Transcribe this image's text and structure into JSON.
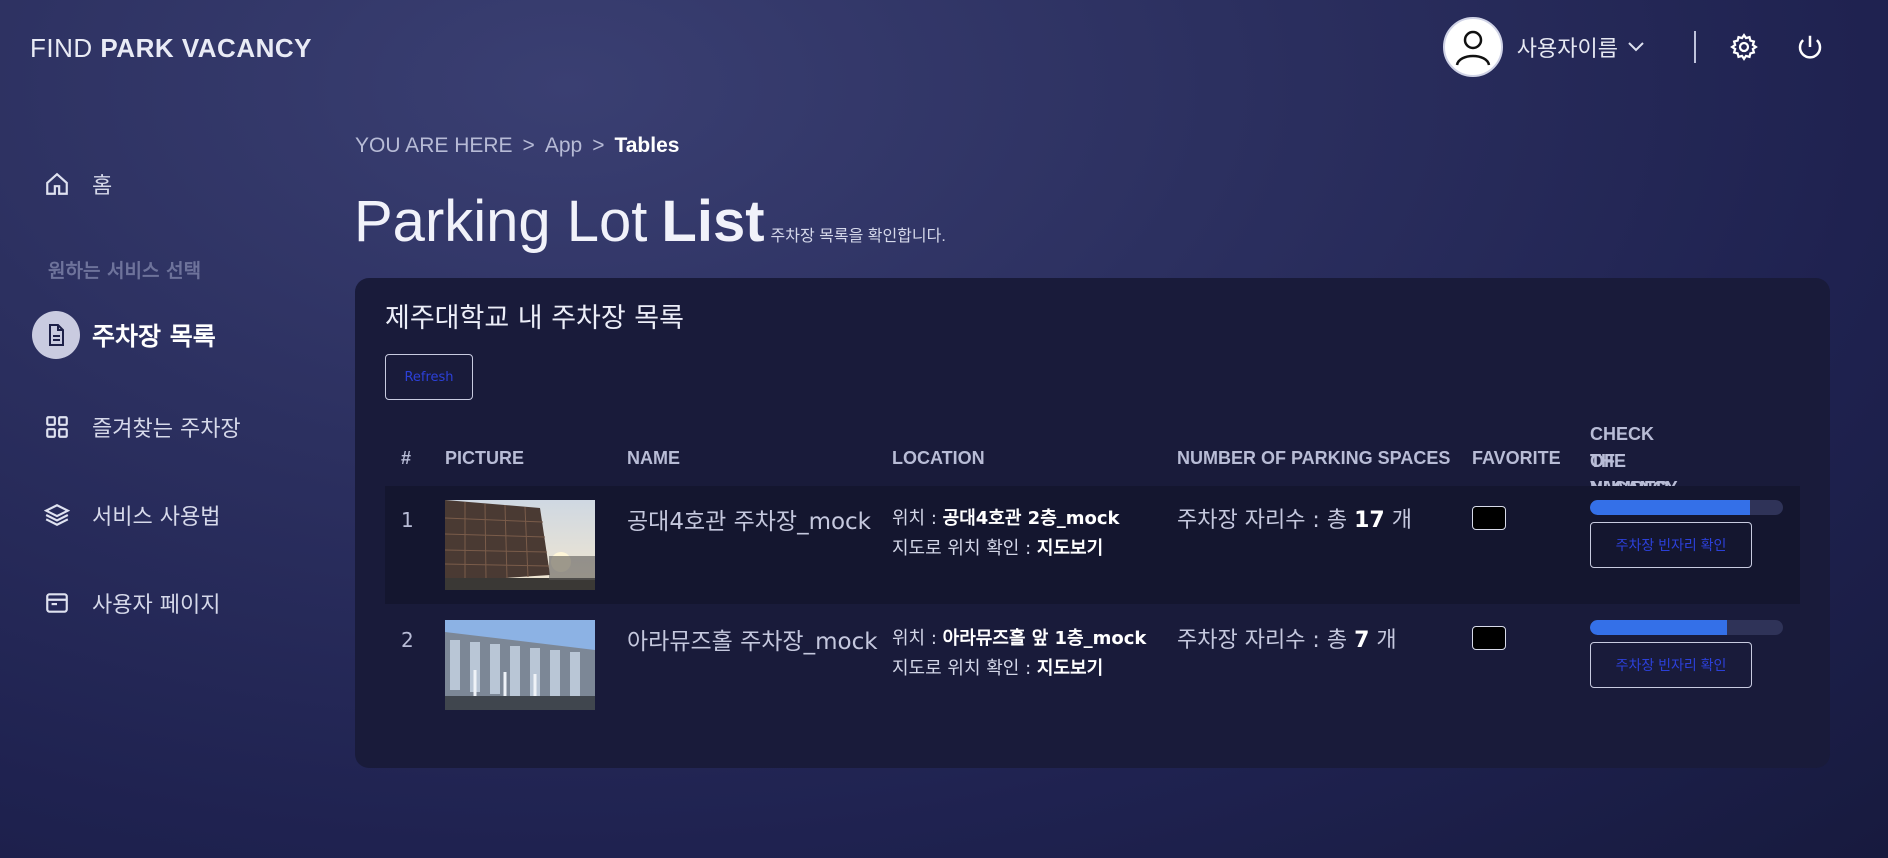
{
  "header": {
    "logo_light": "FIND ",
    "logo_bold": "PARK VACANCY",
    "username": "사용자이름",
    "icons": [
      "user-avatar-icon",
      "chevron-down-icon",
      "gear-icon",
      "power-icon"
    ]
  },
  "sidebar": {
    "home": "홈",
    "section_label": "원하는 서비스 선택",
    "items": [
      {
        "label": "주차장 목록",
        "icon": "document-icon",
        "active": true
      },
      {
        "label": "즐겨찾는 주차장",
        "icon": "grid-icon",
        "active": false
      },
      {
        "label": "서비스 사용법",
        "icon": "layers-icon",
        "active": false
      },
      {
        "label": "사용자 페이지",
        "icon": "browser-window-icon",
        "active": false
      }
    ]
  },
  "breadcrumb": {
    "prefix": "YOU ARE HERE",
    "sep": ">",
    "app": "App",
    "current": "Tables"
  },
  "page": {
    "title_light": "Parking Lot",
    "title_bold": "List",
    "subtitle": "주차장 목록을 확인합니다."
  },
  "card": {
    "title": "제주대학교 내 주차장 목록",
    "refresh_label": "Refresh"
  },
  "table": {
    "headers": {
      "num": "#",
      "picture": "PICTURE",
      "name": "NAME",
      "location": "LOCATION",
      "spaces": "NUMBER OF PARKING SPACES",
      "favorite": "FAVORITE",
      "vacancy_line1": "CHECK THE NUMBER",
      "vacancy_line2": "OF VACANCY"
    },
    "rows": [
      {
        "num": "1",
        "name": "공대4호관 주차장_mock",
        "loc_label": "위치 :",
        "loc_value": "공대4호관 2층_mock",
        "map_label": "지도로 위치 확인 :",
        "map_link": "지도보기",
        "spaces_prefix": "주차장 자리수 : 총",
        "spaces_count": "17",
        "spaces_unit": "개",
        "vacancy_ratio": 0.83,
        "vacancy_button": "주차장 빈자리 확인"
      },
      {
        "num": "2",
        "name": "아라뮤즈홀 주차장_mock",
        "loc_label": "위치 :",
        "loc_value": "아라뮤즈홀 앞 1층_mock",
        "map_label": "지도로 위치 확인 :",
        "map_link": "지도보기",
        "spaces_prefix": "주차장 자리수 : 총",
        "spaces_count": "7",
        "spaces_unit": "개",
        "vacancy_ratio": 0.71,
        "vacancy_button": "주차장 빈자리 확인"
      }
    ]
  },
  "colors": {
    "accent": "#3470e8",
    "button_text": "#2c40d8",
    "card_bg": "#191b3a"
  }
}
